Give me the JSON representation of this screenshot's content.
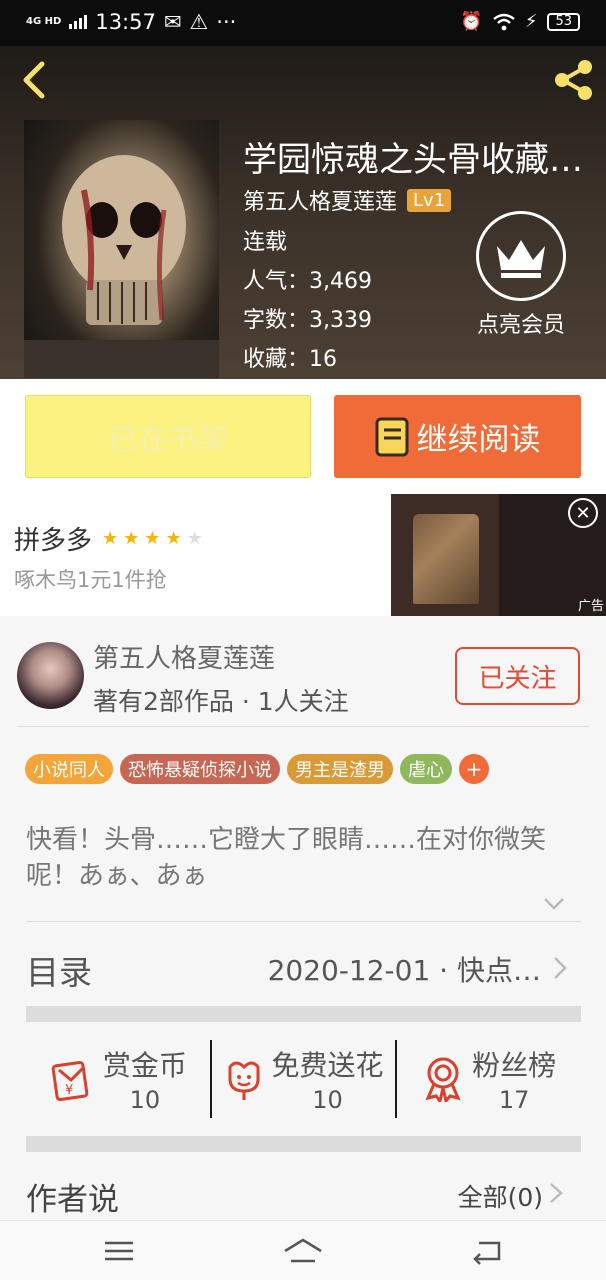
{
  "status_bar": {
    "network": "4G HD",
    "time": "13:57",
    "battery": "53"
  },
  "book": {
    "title": "学园惊魂之头骨收藏…",
    "author": "第五人格夏莲莲",
    "author_level": "Lv1",
    "status": "连载",
    "popularity_label": "人气：",
    "popularity": "3,469",
    "word_count_label": "字数：",
    "word_count": "3,339",
    "favorites_label": "收藏：",
    "favorites": "16"
  },
  "vip": {
    "label": "点亮会员"
  },
  "actions": {
    "shelf_label": "已在书架",
    "read_label": "继续阅读"
  },
  "ad": {
    "title": "拼多多",
    "rating": 4,
    "rating_max": 5,
    "subtitle": "啄木鸟1元1件抢",
    "tag": "广告",
    "close": "✕"
  },
  "author_info": {
    "name": "第五人格夏莲莲",
    "stats": "著有2部作品 · 1人关注",
    "follow_label": "已关注"
  },
  "tags": [
    {
      "label": "小说同人",
      "color": "#f4a53a"
    },
    {
      "label": "恐怖悬疑侦探小说",
      "color": "#c76652"
    },
    {
      "label": "男主是渣男",
      "color": "#d99a37"
    },
    {
      "label": "虐心",
      "color": "#8fb85c"
    }
  ],
  "tag_more": "+",
  "synopsis": "快看！头骨……它瞪大了眼睛……在对你微笑呢！あぁ、あぁ",
  "toc": {
    "label": "目录",
    "latest": "2020-12-01 · 快点…"
  },
  "rewards": [
    {
      "label": "赏金币",
      "count": "10",
      "icon": "red-envelope-icon"
    },
    {
      "label": "免费送花",
      "count": "10",
      "icon": "flower-icon"
    },
    {
      "label": "粉丝榜",
      "count": "17",
      "icon": "medal-icon"
    }
  ],
  "author_says": {
    "label": "作者说",
    "all_label": "全部(0)"
  },
  "colors": {
    "accent": "#f06b37",
    "follow": "#e64a35",
    "shelf": "#fbf280"
  }
}
